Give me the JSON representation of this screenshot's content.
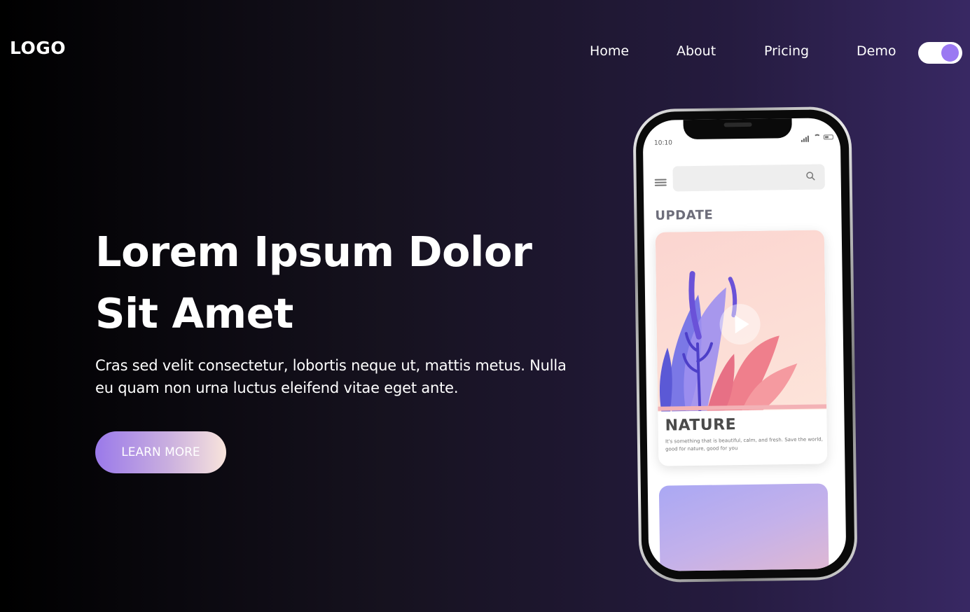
{
  "header": {
    "logo": "LOGO",
    "nav": [
      "Home",
      "About",
      "Pricing",
      "Demo"
    ],
    "theme_toggle": {
      "state": "on",
      "knob_color": "#9b79f2"
    }
  },
  "hero": {
    "title": "Lorem Ipsum Dolor Sit Amet",
    "text": "Cras sed velit consectetur, lobortis neque ut, mattis metus. Nulla eu quam non urna luctus eleifend vitae eget ante.",
    "button": "LEARN MORE"
  },
  "phone": {
    "status_time": "10:10",
    "section_label": "UPDATE",
    "card": {
      "title": "NATURE",
      "description": "It's something that is beautiful, calm, and fresh. Save the world, good for nature, good for you"
    }
  },
  "colors": {
    "accent": "#9b79f2",
    "background_start": "#000000",
    "background_end": "#382863"
  }
}
